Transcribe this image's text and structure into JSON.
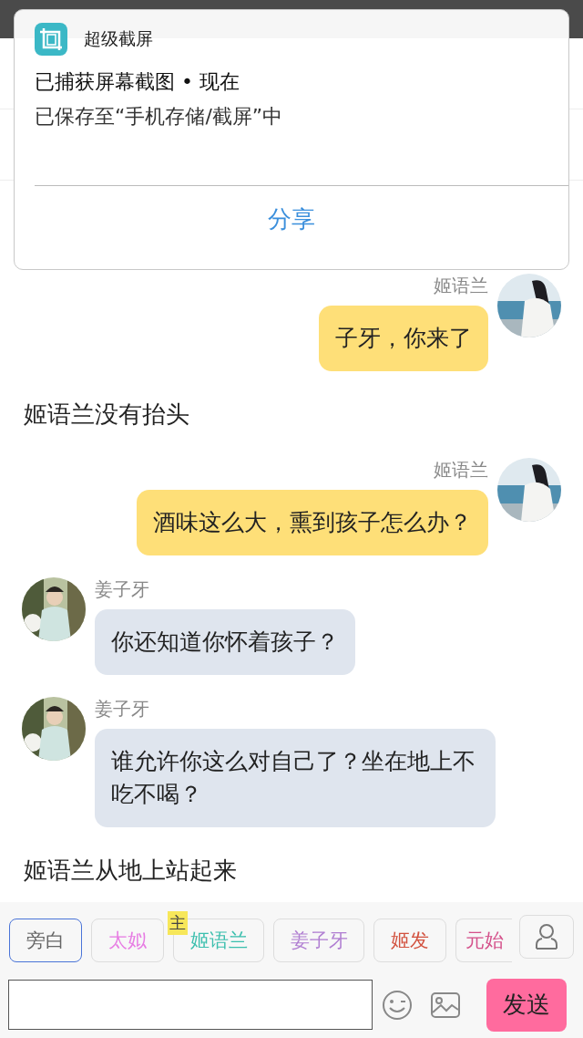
{
  "notification": {
    "app": "超级截屏",
    "title": "已捕获屏幕截图 • 现在",
    "body": "已保存至“手机存储/截屏”中",
    "action": "分享"
  },
  "messages": [
    {
      "kind": "sent",
      "name": "姬语兰",
      "text": "子牙，你来了"
    },
    {
      "kind": "narration",
      "text": "姬语兰没有抬头"
    },
    {
      "kind": "sent",
      "name": "姬语兰",
      "text": "酒味这么大，熏到孩子怎么办？"
    },
    {
      "kind": "received",
      "name": "姜子牙",
      "text": "你还知道你怀着孩子？"
    },
    {
      "kind": "received",
      "name": "姜子牙",
      "text": "谁允许你这么对自己了？坐在地上不吃不喝？"
    },
    {
      "kind": "narration",
      "text": "姬语兰从地上站起来"
    }
  ],
  "roles": [
    {
      "label": "旁白",
      "color": "#666666",
      "selected": true
    },
    {
      "label": "太姒",
      "color": "#e77be3",
      "selected": false
    },
    {
      "label": "姬语兰",
      "color": "#3cbfae",
      "selected": false,
      "badge": "主"
    },
    {
      "label": "姜子牙",
      "color": "#b07ed2",
      "selected": false
    },
    {
      "label": "姬发",
      "color": "#d2513e",
      "selected": false
    },
    {
      "label": "元始",
      "color": "#d4508a",
      "selected": false
    }
  ],
  "send": "发送"
}
